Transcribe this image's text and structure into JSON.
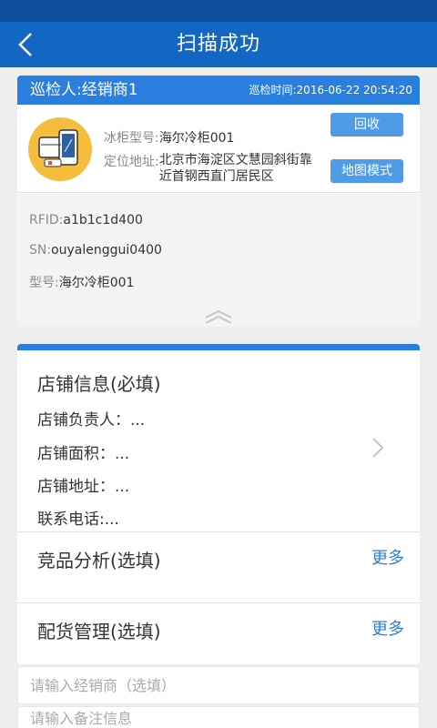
{
  "header": {
    "title": "扫描成功"
  },
  "inspection": {
    "inspector": "巡检人:经销商1",
    "time": "巡检时间:2016-06-22 20:54:20"
  },
  "fridge": {
    "model_label": "冰柜型号:",
    "model_value": "海尔冷柜001",
    "address_label": "定位地址:",
    "address_value": "北京市海淀区文慧园斜街靠近首钢西直门居民区",
    "recycle_button": "回收",
    "map_button": "地图模式"
  },
  "details": {
    "rfid_label": "RFID:",
    "rfid_value": "a1b1c1d400",
    "sn_label": "SN:",
    "sn_value": "ouyalenggui0400",
    "type_label": "型号:",
    "type_value": "海尔冷柜001"
  },
  "shop": {
    "title": "店铺信息(必填)",
    "owner": "店铺负责人：...",
    "area": "店铺面积：...",
    "address": "店铺地址：...",
    "phone": "联系电话:..."
  },
  "competitor": {
    "title": "竞品分析(选填)",
    "more": "更多"
  },
  "distribution": {
    "title": "配货管理(选填)",
    "more": "更多"
  },
  "inputs": {
    "dealer_placeholder": "请输入经销商（选填）",
    "remark_placeholder": "请输入备注信息"
  },
  "colors": {
    "primary": "#1466c3",
    "accent": "#2a7fde",
    "button": "#4f9be7",
    "icon_bg": "#f5bd3c"
  },
  "icons": [
    "back-arrow-icon",
    "fridge-card-icon",
    "chevron-up-icon",
    "chevron-right-icon"
  ]
}
